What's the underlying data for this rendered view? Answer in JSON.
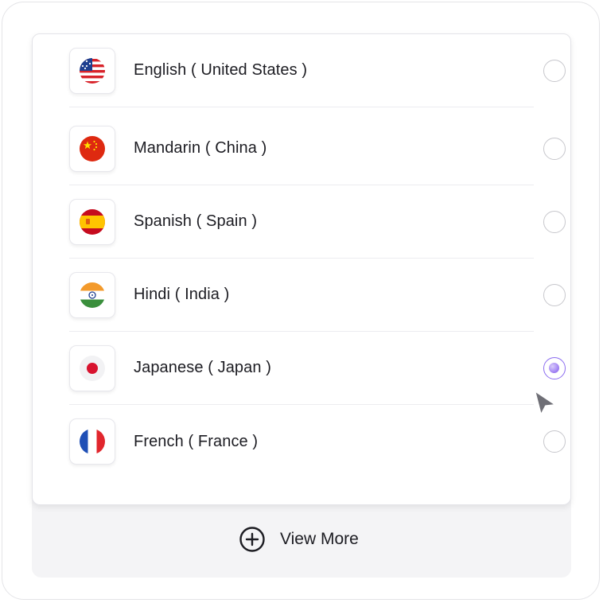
{
  "languages": [
    {
      "label": "English ( United States )",
      "flag": "us-flag-icon",
      "selected": false
    },
    {
      "label": "Mandarin ( China )",
      "flag": "china-flag-icon",
      "selected": false
    },
    {
      "label": "Spanish ( Spain )",
      "flag": "spain-flag-icon",
      "selected": false
    },
    {
      "label": "Hindi ( India )",
      "flag": "india-flag-icon",
      "selected": false
    },
    {
      "label": "Japanese ( Japan )",
      "flag": "japan-flag-icon",
      "selected": true
    },
    {
      "label": "French ( France )",
      "flag": "france-flag-icon",
      "selected": false
    }
  ],
  "view_more": {
    "label": "View More",
    "icon": "plus-circle-icon"
  },
  "colors": {
    "accent": "#8b6cf0",
    "text": "#1c1c22",
    "border": "#e3e3e8",
    "tray": "#f4f4f6"
  }
}
